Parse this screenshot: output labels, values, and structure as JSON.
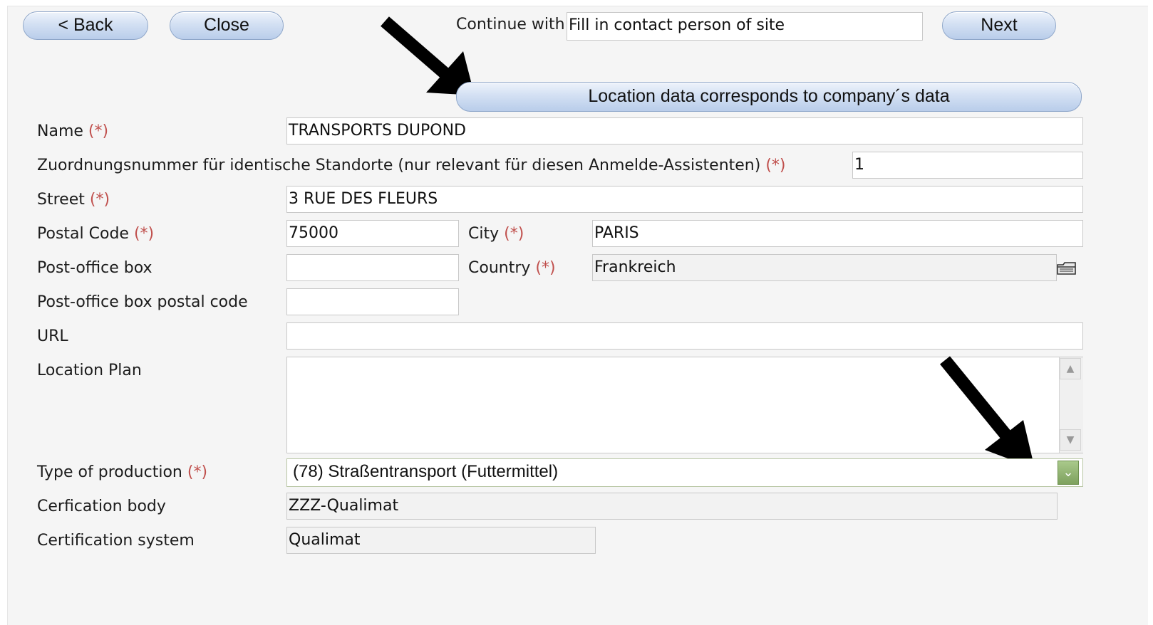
{
  "toolbar": {
    "back_label": "< Back",
    "close_label": "Close",
    "continue_label": "Continue with:",
    "continue_value": "Fill in contact person of site",
    "next_label": "Next"
  },
  "location_button_label": "Location data corresponds to company´s data",
  "required_marker": "(*)",
  "form": {
    "name_label": "Name",
    "name_value": "TRANSPORTS DUPOND",
    "assign_label": "Zuordnungsnummer für identische Standorte (nur relevant für diesen Anmelde-Assistenten)",
    "assign_value": "1",
    "street_label": "Street",
    "street_value": "3 RUE DES FLEURS",
    "postal_label": "Postal Code",
    "postal_value": "75000",
    "city_label": "City",
    "city_value": "PARIS",
    "pobox_label": "Post-office box",
    "pobox_value": "",
    "country_label": "Country",
    "country_value": "Frankreich",
    "pobox_postal_label": "Post-office box postal code",
    "pobox_postal_value": "",
    "url_label": "URL",
    "url_value": "",
    "plan_label": "Location Plan",
    "plan_value": "",
    "type_label": "Type of production",
    "type_value": "(78) Straßentransport (Futtermittel)",
    "body_label": "Cerfication body",
    "body_value": "ZZZ-Qualimat",
    "system_label": "Certification system",
    "system_value": "Qualimat"
  },
  "icons": {
    "arrow": "black-arrow-icon",
    "folder": "folder-icon",
    "dropdown": "chevron-down-icon",
    "scroll_up": "scroll-up-icon",
    "scroll_down": "scroll-down-icon"
  },
  "colors": {
    "required": "#c0504d",
    "button": "#c9d8ef",
    "dropdown": "#8db26c"
  }
}
